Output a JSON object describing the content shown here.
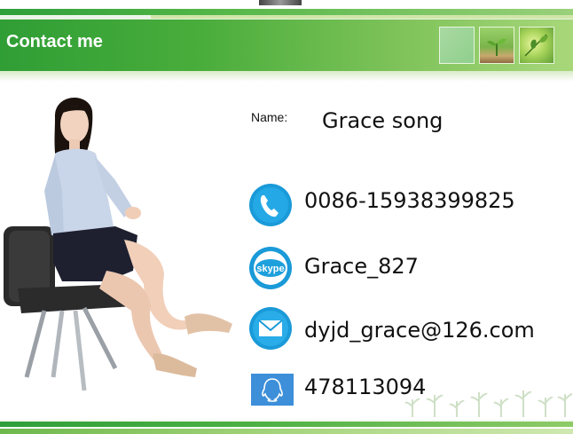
{
  "header": {
    "title": "Contact me"
  },
  "profile": {
    "name_label": "Name:",
    "name_value": "Grace song"
  },
  "contacts": {
    "phone": {
      "icon": "phone-icon",
      "value": "0086-15938399825"
    },
    "skype": {
      "icon": "skype-icon",
      "value": "Grace_827"
    },
    "email": {
      "icon": "mail-icon",
      "value": "dyjd_grace@126.com"
    },
    "qq": {
      "icon": "qq-icon",
      "value": "478113094"
    }
  },
  "colors": {
    "header_green": "#3aa33a",
    "light_green": "#a8d77a",
    "icon_blue": "#1a9ad8"
  }
}
